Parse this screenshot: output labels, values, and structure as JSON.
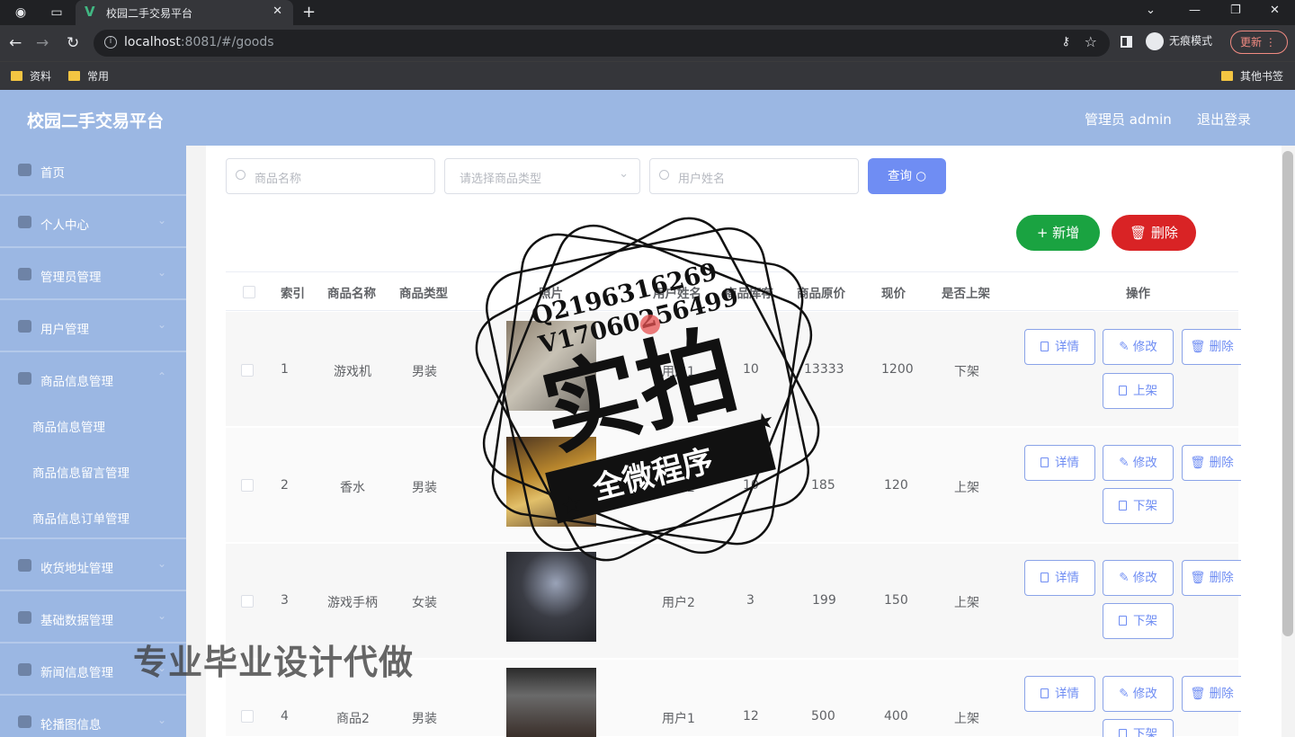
{
  "browser": {
    "tab_title": "校园二手交易平台",
    "url_host": "localhost",
    "url_rest": ":8081/#/goods",
    "incognito_label": "无痕模式",
    "update_label": "更新",
    "bookmarks": [
      "资料",
      "常用"
    ],
    "other_bookmarks": "其他书签"
  },
  "header": {
    "title": "校园二手交易平台",
    "admin": "管理员 admin",
    "logout": "退出登录"
  },
  "sidebar": {
    "items": [
      {
        "label": "首页"
      },
      {
        "label": "个人中心"
      },
      {
        "label": "管理员管理"
      },
      {
        "label": "用户管理"
      },
      {
        "label": "商品信息管理"
      },
      {
        "label": "收货地址管理"
      },
      {
        "label": "基础数据管理"
      },
      {
        "label": "新闻信息管理"
      },
      {
        "label": "轮播图信息"
      }
    ],
    "sub_items": [
      {
        "label": "商品信息管理"
      },
      {
        "label": "商品信息留言管理"
      },
      {
        "label": "商品信息订单管理"
      }
    ]
  },
  "search": {
    "name_placeholder": "商品名称",
    "type_placeholder": "请选择商品类型",
    "user_placeholder": "用户姓名",
    "query_label": "查询"
  },
  "actions": {
    "add_label": "+ 新增",
    "delete_label": "删除"
  },
  "table": {
    "headers": [
      "索引",
      "商品名称",
      "商品类型",
      "照片",
      "用户姓名",
      "商品库存",
      "商品原价",
      "现价",
      "是否上架",
      "操作"
    ],
    "rows": [
      {
        "index": "1",
        "name": "游戏机",
        "type": "男装",
        "user": "用户1",
        "stock": "10",
        "orig": "13333",
        "price": "1200",
        "status": "下架",
        "toggle": "上架"
      },
      {
        "index": "2",
        "name": "香水",
        "type": "男装",
        "user": "用户2",
        "stock": "10",
        "orig": "185",
        "price": "120",
        "status": "上架",
        "toggle": "下架"
      },
      {
        "index": "3",
        "name": "游戏手柄",
        "type": "女装",
        "user": "用户2",
        "stock": "3",
        "orig": "199",
        "price": "150",
        "status": "上架",
        "toggle": "下架"
      },
      {
        "index": "4",
        "name": "商品2",
        "type": "男装",
        "user": "用户1",
        "stock": "12",
        "orig": "500",
        "price": "400",
        "status": "上架",
        "toggle": "下架"
      }
    ],
    "op_labels": {
      "detail": "详情",
      "edit": "修改",
      "delete": "删除"
    }
  },
  "watermark": {
    "qq": "Q2196316269",
    "vx": "V17060256499",
    "big": "实拍",
    "ribbon": "全微程序",
    "bottom": "专业毕业设计代做"
  }
}
